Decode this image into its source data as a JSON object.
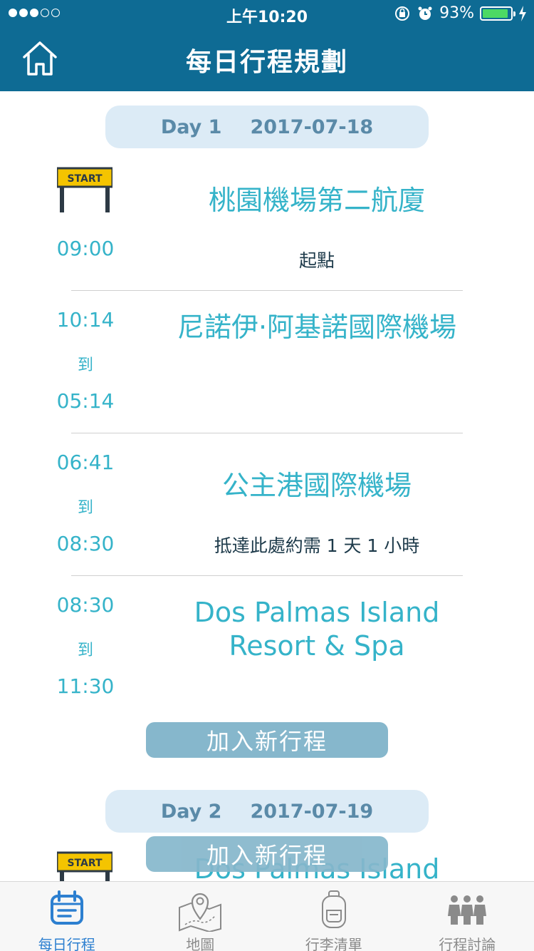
{
  "status": {
    "time": "上午10:20",
    "battery": "93%",
    "battery_level": 0.93
  },
  "nav": {
    "title": "每日行程規劃",
    "home_icon": "home-icon"
  },
  "days": [
    {
      "label": "Day 1",
      "date": "2017-07-18",
      "start_sign": "START",
      "entries": [
        {
          "time": "09:00",
          "place": "桃園機場第二航廈",
          "note": "起點"
        },
        {
          "time_start": "10:14",
          "to": "到",
          "time_end": "05:14",
          "place": "尼諾伊·阿基諾國際機場"
        },
        {
          "time_start": "06:41",
          "to": "到",
          "time_end": "08:30",
          "place": "公主港國際機場",
          "note": "抵達此處約需 1 天 1 小時"
        },
        {
          "time_start": "08:30",
          "to": "到",
          "time_end": "11:30",
          "place": "Dos Palmas Island Resort & Spa"
        }
      ],
      "add_button": "加入新行程"
    },
    {
      "label": "Day 2",
      "date": "2017-07-19",
      "start_sign": "START",
      "first_place": "Dos Palmas Island",
      "add_button": "加入新行程"
    }
  ],
  "tabs": [
    {
      "label": "每日行程",
      "icon": "calendar-icon",
      "active": true
    },
    {
      "label": "地圖",
      "icon": "map-icon",
      "active": false
    },
    {
      "label": "行李清單",
      "icon": "backpack-icon",
      "active": false
    },
    {
      "label": "行程討論",
      "icon": "people-icon",
      "active": false
    }
  ],
  "colors": {
    "nav": "#0e6b94",
    "accent": "#35b3c9",
    "button": "#86b7cc",
    "day_header": "#dcebf6",
    "tab_active": "#2c7fd0"
  }
}
